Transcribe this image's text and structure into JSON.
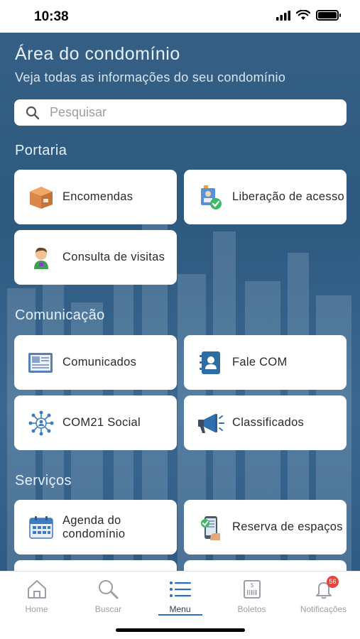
{
  "status_bar": {
    "time": "10:38"
  },
  "header": {
    "title": "Área do condomínio",
    "subtitle": "Veja todas as informações do seu condomínio"
  },
  "search": {
    "placeholder": "Pesquisar"
  },
  "sections": {
    "portaria": {
      "title": "Portaria",
      "items": [
        {
          "label": "Encomendas",
          "icon": "package-icon"
        },
        {
          "label": "Liberação de acesso",
          "icon": "access-badge-icon"
        },
        {
          "label": "Consulta de visitas",
          "icon": "visitor-icon"
        }
      ]
    },
    "comunicacao": {
      "title": "Comunicação",
      "items": [
        {
          "label": "Comunicados",
          "icon": "newspaper-icon"
        },
        {
          "label": "Fale COM",
          "icon": "contact-book-icon"
        },
        {
          "label": "COM21 Social",
          "icon": "social-network-icon"
        },
        {
          "label": "Classificados",
          "icon": "megaphone-icon"
        }
      ]
    },
    "servicos": {
      "title": "Serviços",
      "items": [
        {
          "label": "Agenda do condomínio",
          "icon": "calendar-icon"
        },
        {
          "label": "Reserva de espaços",
          "icon": "booking-icon"
        }
      ]
    }
  },
  "tab_bar": {
    "tabs": [
      {
        "label": "Home",
        "icon": "home-icon"
      },
      {
        "label": "Buscar",
        "icon": "search-icon"
      },
      {
        "label": "Menu",
        "icon": "menu-icon",
        "active": true
      },
      {
        "label": "Boletos",
        "icon": "bill-icon"
      },
      {
        "label": "Notificações",
        "icon": "bell-icon",
        "badge": "56"
      }
    ]
  },
  "colors": {
    "background": "#2f5b83",
    "card": "#ffffff",
    "header_text": "#e6f0f7",
    "active_tab_underline": "#2d6fb6",
    "badge": "#e8453c"
  }
}
